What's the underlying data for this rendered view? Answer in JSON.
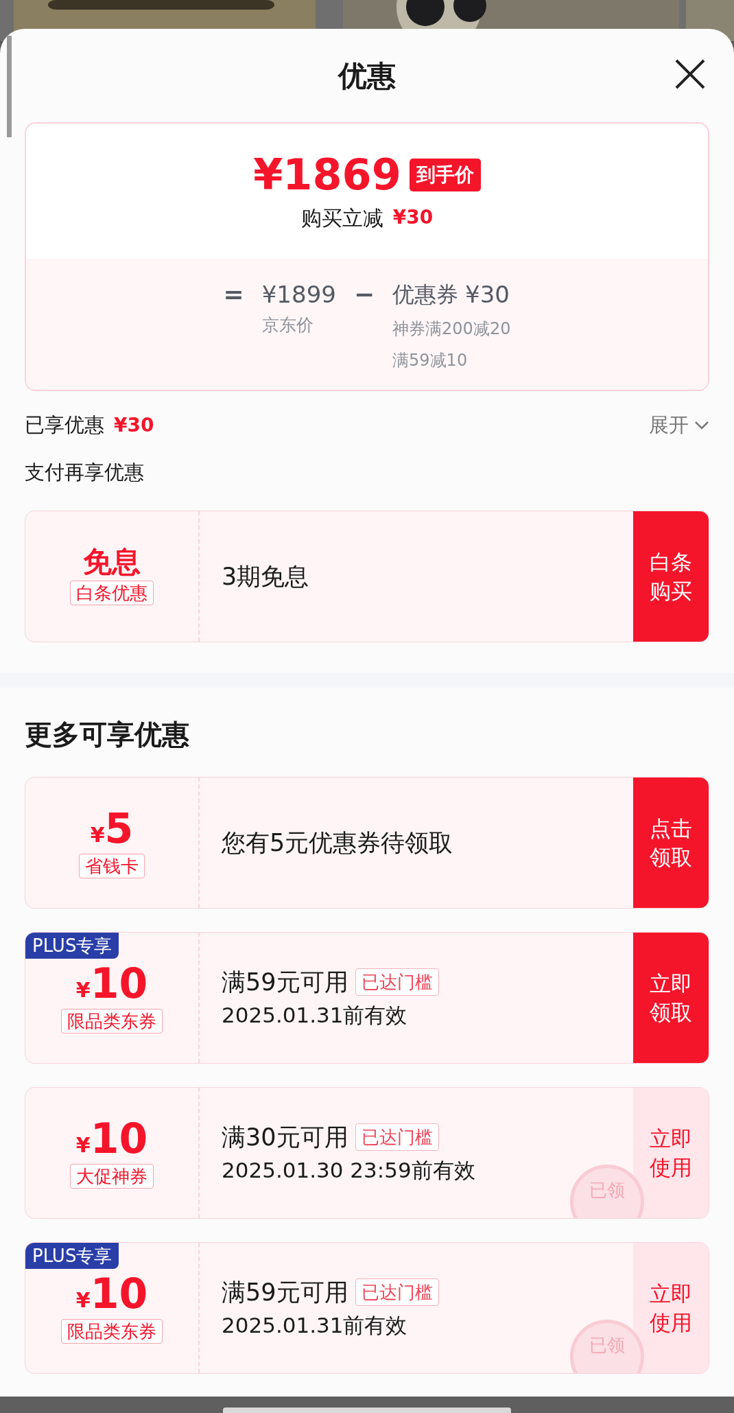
{
  "sheet": {
    "title": "优惠"
  },
  "price_card": {
    "price": "¥1869",
    "price_tag": "到手价",
    "saving_label": "购买立减",
    "saving_amount": "¥30",
    "equals": "=",
    "jd_price": "¥1899",
    "jd_price_label": "京东价",
    "minus": "−",
    "coupon_label": "优惠券",
    "coupon_amount": "¥30",
    "details": [
      "神券满200减20",
      "满59减10"
    ]
  },
  "enjoyed": {
    "label": "已享优惠",
    "amount": "¥30",
    "toggle": "展开"
  },
  "payment_section": {
    "title": "支付再享优惠",
    "offers": [
      {
        "kind": "claim",
        "title": "免息",
        "tag": "白条优惠",
        "text": "3期免息",
        "action": "白条购买"
      }
    ]
  },
  "more_section": {
    "title": "更多可享优惠",
    "coupons": [
      {
        "kind": "claim",
        "currency": "¥",
        "amount": "5",
        "tag": "省钱卡",
        "text": "您有5元优惠券待领取",
        "action": "点击领取"
      },
      {
        "kind": "claim",
        "badge": "PLUS专享",
        "currency": "¥",
        "amount": "10",
        "tag": "限品类东券",
        "condition": "满59元可用",
        "threshold": "已达门槛",
        "validity": "2025.01.31前有效",
        "action": "立即领取"
      },
      {
        "kind": "use",
        "currency": "¥",
        "amount": "10",
        "tag": "大促神券",
        "condition": "满30元可用",
        "threshold": "已达门槛",
        "validity": "2025.01.30 23:59前有效",
        "action": "立即使用",
        "stamp": "已领"
      },
      {
        "kind": "use",
        "badge": "PLUS专享",
        "currency": "¥",
        "amount": "10",
        "tag": "限品类东券",
        "condition": "满59元可用",
        "threshold": "已达门槛",
        "validity": "2025.01.31前有效",
        "action": "立即使用",
        "stamp": "已领"
      }
    ]
  }
}
